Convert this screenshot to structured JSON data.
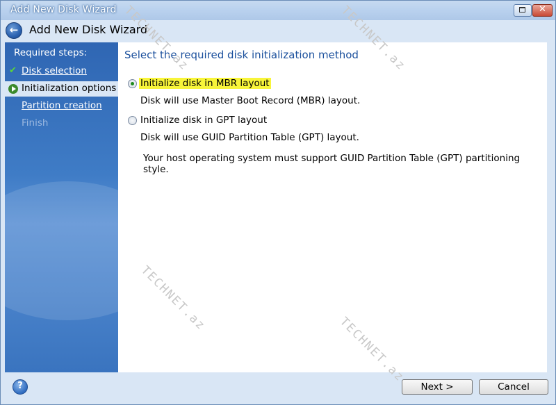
{
  "window": {
    "title": "Add New Disk Wizard"
  },
  "header": {
    "title": "Add New Disk Wizard"
  },
  "sidebar": {
    "heading": "Required steps:",
    "steps": [
      {
        "label": "Disk selection",
        "state": "done"
      },
      {
        "label": "Initialization options",
        "state": "current"
      },
      {
        "label": "Partition creation",
        "state": "link"
      },
      {
        "label": "Finish",
        "state": "disabled"
      }
    ]
  },
  "content": {
    "heading": "Select the required disk initialization method",
    "options": [
      {
        "label": "Initialize disk in MBR layout",
        "description": "Disk will use Master Boot Record (MBR) layout.",
        "checked": true
      },
      {
        "label": "Initialize disk in GPT layout",
        "description": "Disk will use GUID Partition Table (GPT) layout.",
        "checked": false
      }
    ],
    "note": "Your host operating system must support GUID Partition Table (GPT) partitioning style."
  },
  "footer": {
    "next_label": "Next >",
    "cancel_label": "Cancel"
  },
  "watermark": "TECHNET.az",
  "colors": {
    "accent_blue": "#1a4f9c",
    "sidebar_blue": "#3f7cc6",
    "highlight_yellow": "#f8f53a"
  },
  "icons": [
    "back-icon",
    "checkmark-icon",
    "arrow-right-icon",
    "help-icon",
    "maximize-icon",
    "close-icon"
  ]
}
